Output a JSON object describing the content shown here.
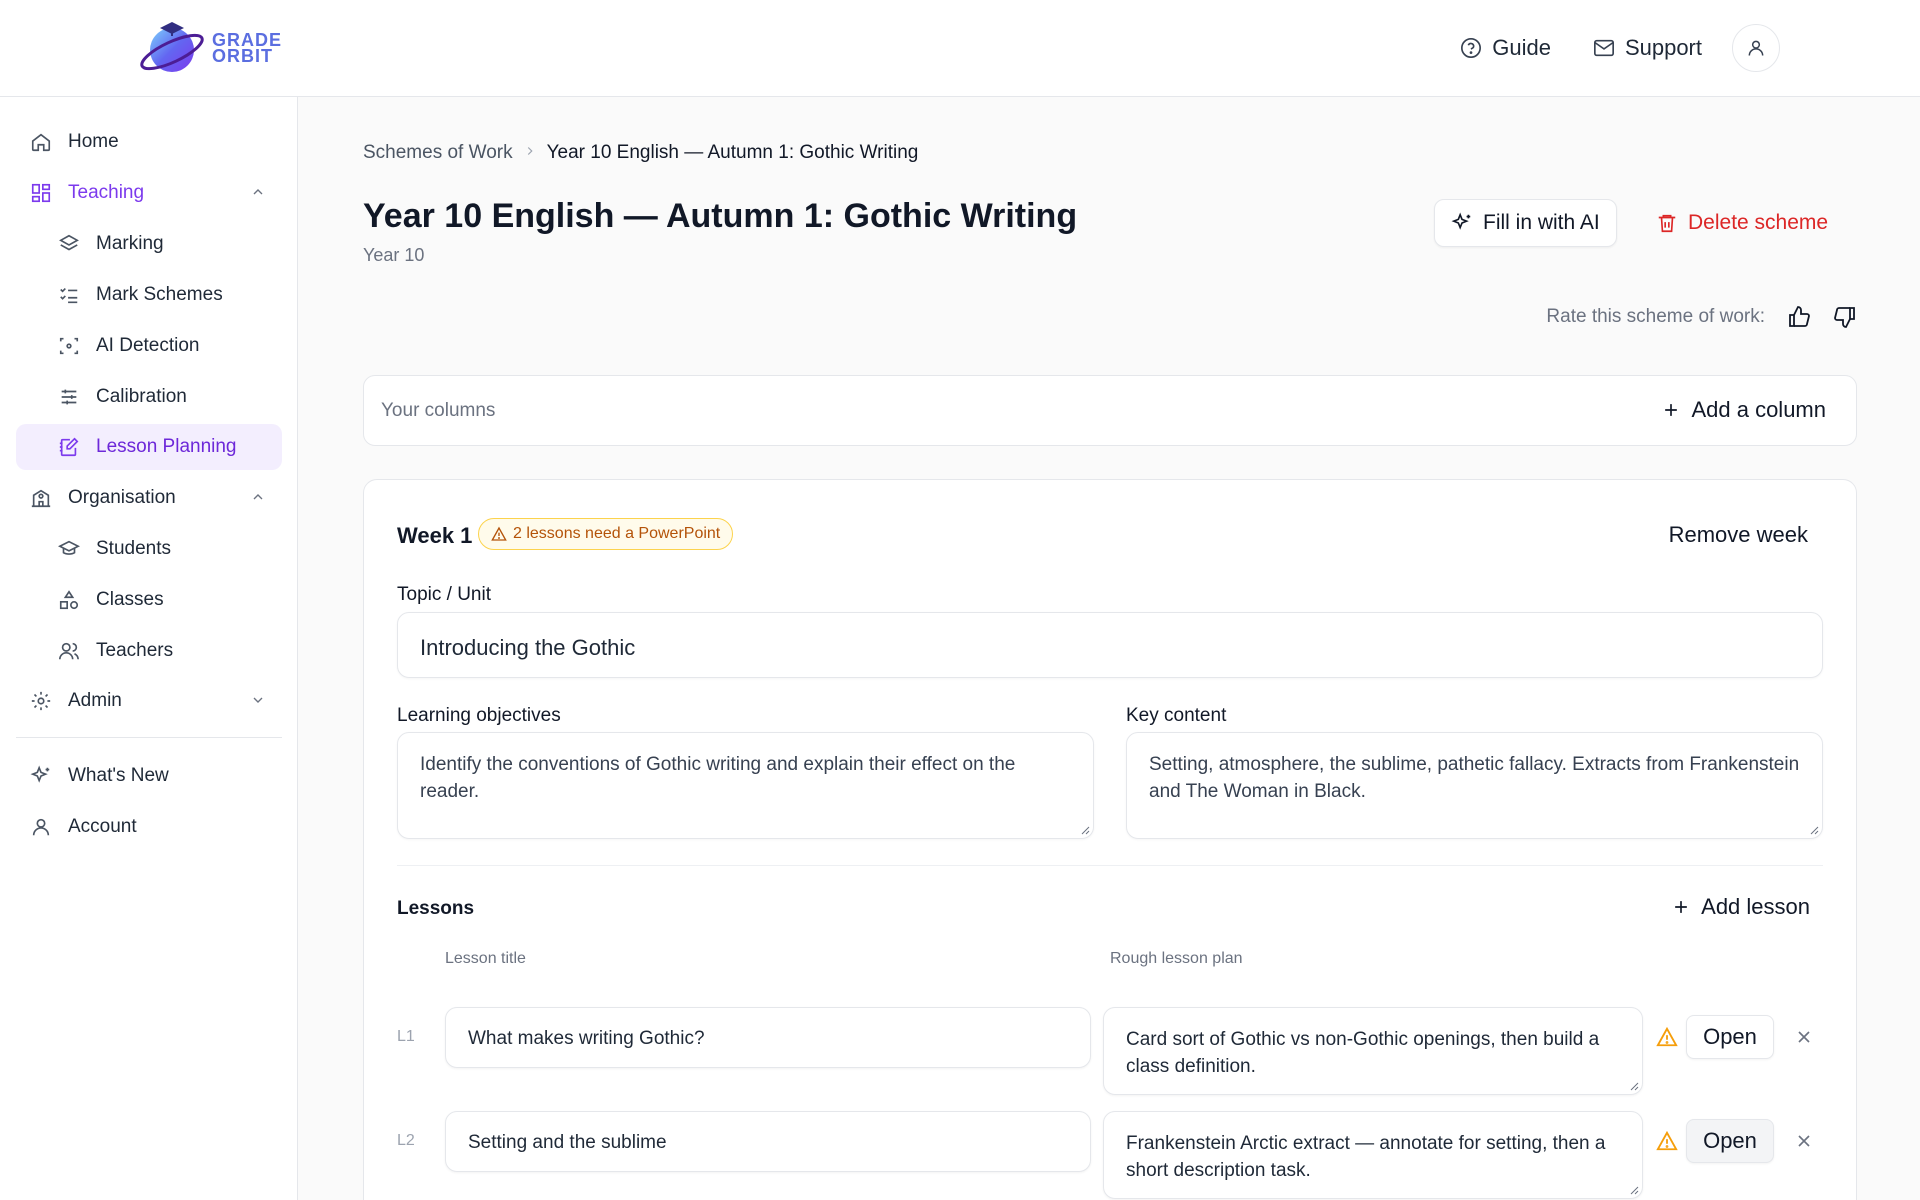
{
  "brand": {
    "line1": "GRADE",
    "line2": "ORBIT"
  },
  "header": {
    "guide": "Guide",
    "support": "Support"
  },
  "sidebar": {
    "home": "Home",
    "teaching": "Teaching",
    "marking": "Marking",
    "mark_schemes": "Mark Schemes",
    "ai_detection": "AI Detection",
    "calibration": "Calibration",
    "lesson_planning": "Lesson Planning",
    "organisation": "Organisation",
    "students": "Students",
    "classes": "Classes",
    "teachers": "Teachers",
    "admin": "Admin",
    "whats_new": "What's New",
    "account": "Account"
  },
  "breadcrumb": {
    "parent": "Schemes of Work",
    "current": "Year 10 English — Autumn 1: Gothic Writing"
  },
  "page": {
    "title": "Year 10 English — Autumn 1: Gothic Writing",
    "subtitle": "Year 10",
    "fill_ai": "Fill in with AI",
    "delete": "Delete scheme",
    "rate_label": "Rate this scheme of work:"
  },
  "columns": {
    "label": "Your columns",
    "add": "Add a column"
  },
  "week": {
    "title": "Week 1",
    "warning": "2 lessons need a PowerPoint",
    "remove": "Remove week",
    "topic_label": "Topic / Unit",
    "topic_value": "Introducing the Gothic",
    "objectives_label": "Learning objectives",
    "objectives_value": "Identify the conventions of Gothic writing and explain their effect on the reader.",
    "content_label": "Key content",
    "content_value": "Setting, atmosphere, the sublime, pathetic fallacy. Extracts from Frankenstein and The Woman in Black.",
    "lessons_label": "Lessons",
    "add_lesson": "Add lesson",
    "col_title": "Lesson title",
    "col_plan": "Rough lesson plan",
    "open_label": "Open",
    "lessons": [
      {
        "num": "L1",
        "title": "What makes writing Gothic?",
        "plan": "Card sort of Gothic vs non-Gothic openings, then build a class definition."
      },
      {
        "num": "L2",
        "title": "Setting and the sublime",
        "plan": "Frankenstein Arctic extract — annotate for setting, then a short description task."
      }
    ]
  }
}
